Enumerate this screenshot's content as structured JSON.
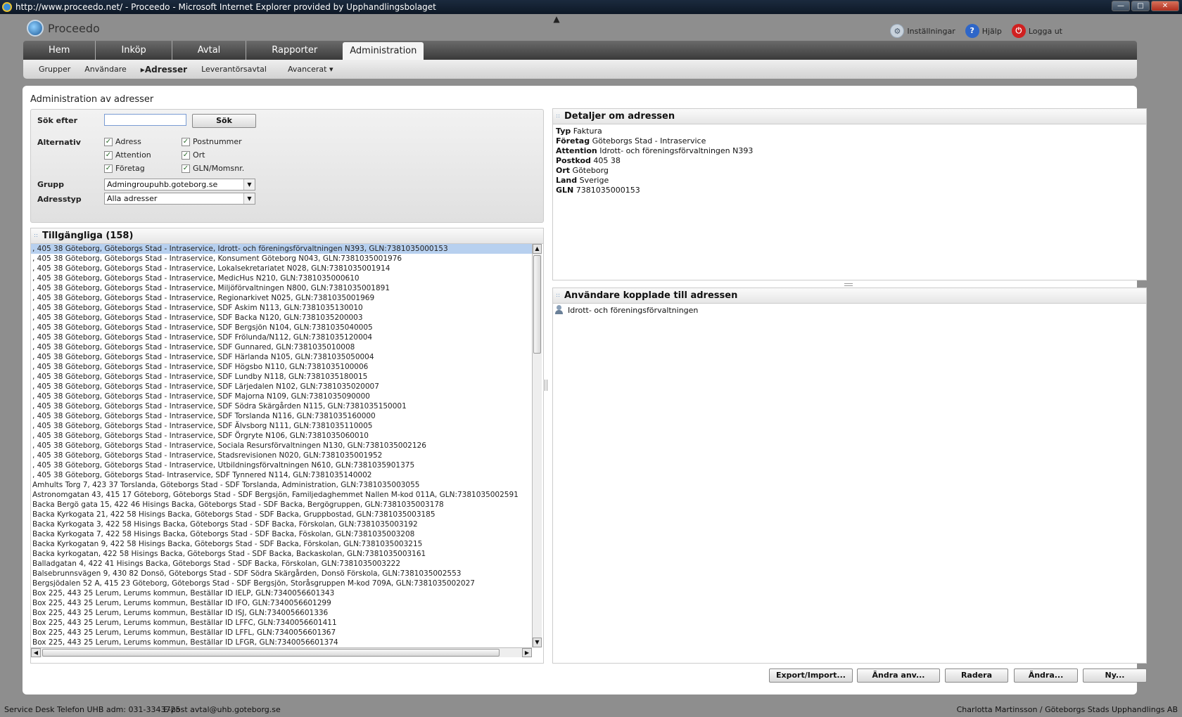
{
  "window": {
    "title": "http://www.proceedo.net/ - Proceedo - Microsoft Internet Explorer provided by Upphandlingsbolaget",
    "min": "—",
    "max": "□",
    "close": "✕"
  },
  "app": {
    "logo_text": "Proceedo",
    "toplinks": {
      "settings": "Inställningar",
      "help": "Hjälp",
      "logout": "Logga ut"
    }
  },
  "nav": {
    "tabs": [
      "Hem",
      "Inköp",
      "Avtal",
      "Rapporter",
      "Administration"
    ],
    "active": "Administration",
    "sub": [
      "Grupper",
      "Användare",
      "Adresser",
      "Leverantörsavtal",
      "Avancerat"
    ],
    "sub_active": "Adresser"
  },
  "page": {
    "title": "Administration av adresser",
    "search_label": "Sök efter",
    "search_value": "",
    "search_button": "Sök",
    "options_label": "Alternativ",
    "options": [
      {
        "label": "Adress",
        "checked": true
      },
      {
        "label": "Postnummer",
        "checked": true
      },
      {
        "label": "Attention",
        "checked": true
      },
      {
        "label": "Ort",
        "checked": true
      },
      {
        "label": "Företag",
        "checked": true
      },
      {
        "label": "GLN/Momsnr.",
        "checked": true
      }
    ],
    "group_label": "Grupp",
    "group_value": "Admingroupuhb.goteborg.se",
    "addrtype_label": "Adresstyp",
    "addrtype_value": "Alla adresser"
  },
  "list": {
    "header": "Tillgängliga (158)",
    "rows": [
      ", 405 38 Göteborg, Göteborgs Stad - Intraservice, Idrott- och föreningsförvaltningen N393, GLN:7381035000153",
      ", 405 38 Göteborg, Göteborgs Stad - Intraservice, Konsument Göteborg N043, GLN:7381035001976",
      ", 405 38 Göteborg, Göteborgs Stad - Intraservice, Lokalsekretariatet N028, GLN:7381035001914",
      ", 405 38 Göteborg, Göteborgs Stad - Intraservice, MedicHus N210, GLN:7381035000610",
      ", 405 38 Göteborg, Göteborgs Stad - Intraservice, Miljöförvaltningen N800, GLN:7381035001891",
      ", 405 38 Göteborg, Göteborgs Stad - Intraservice, Regionarkivet N025, GLN:7381035001969",
      ", 405 38 Göteborg, Göteborgs Stad - Intraservice, SDF Askim N113, GLN:7381035130010",
      ", 405 38 Göteborg, Göteborgs Stad - Intraservice, SDF Backa N120, GLN:7381035200003",
      ", 405 38 Göteborg, Göteborgs Stad - Intraservice, SDF Bergsjön N104, GLN:7381035040005",
      ", 405 38 Göteborg, Göteborgs Stad - Intraservice, SDF Frölunda/N112, GLN:7381035120004",
      ", 405 38 Göteborg, Göteborgs Stad - Intraservice, SDF Gunnared, GLN:7381035010008",
      ", 405 38 Göteborg, Göteborgs Stad - Intraservice, SDF Härlanda N105, GLN:7381035050004",
      ", 405 38 Göteborg, Göteborgs Stad - Intraservice, SDF Högsbo N110, GLN:7381035100006",
      ", 405 38 Göteborg, Göteborgs Stad - Intraservice, SDF Lundby N118, GLN:7381035180015",
      ", 405 38 Göteborg, Göteborgs Stad - Intraservice, SDF Lärjedalen N102, GLN:7381035020007",
      ", 405 38 Göteborg, Göteborgs Stad - Intraservice, SDF Majorna N109, GLN:7381035090000",
      ", 405 38 Göteborg, Göteborgs Stad - Intraservice, SDF Södra Skärgården N115, GLN:7381035150001",
      ", 405 38 Göteborg, Göteborgs Stad - Intraservice, SDF Torslanda N116, GLN:7381035160000",
      ", 405 38 Göteborg, Göteborgs Stad - Intraservice, SDF Älvsborg N111, GLN:7381035110005",
      ", 405 38 Göteborg, Göteborgs Stad - Intraservice, SDF Örgryte N106, GLN:7381035060010",
      ", 405 38 Göteborg, Göteborgs Stad - Intraservice, Sociala Resursförvaltningen N130, GLN:7381035002126",
      ", 405 38 Göteborg, Göteborgs Stad - Intraservice, Stadsrevisionen N020, GLN:7381035001952",
      ", 405 38 Göteborg, Göteborgs Stad - Intraservice, Utbildningsförvaltningen N610, GLN:7381035901375",
      ", 405 38 Göteborg, Göteborgs Stad- Intraservice, SDF Tynnered N114, GLN:7381035140002",
      "Amhults Torg 7, 423 37 Torslanda, Göteborgs Stad - SDF Torslanda, Administration, GLN:7381035003055",
      "Astronomgatan 43, 415 17 Göteborg, Göteborgs Stad - SDF Bergsjön, Familjedaghemmet Nallen M-kod 011A, GLN:7381035002591",
      "Backa Bergö gata 15, 422 46 Hisings Backa, Göteborgs Stad - SDF Backa, Bergögruppen, GLN:7381035003178",
      "Backa Kyrkogata 21, 422 58 Hisings Backa, Göteborgs Stad - SDF Backa, Gruppbostad, GLN:7381035003185",
      "Backa Kyrkogata 3, 422 58 Hisings Backa, Göteborgs Stad - SDF Backa, Förskolan, GLN:7381035003192",
      "Backa Kyrkogata 7, 422 58 Hisings Backa, Göteborgs Stad - SDF Backa, Föskolan, GLN:7381035003208",
      "Backa Kyrkogatan 9, 422 58 Hisings Backa, Göteborgs Stad - SDF Backa, Förskolan, GLN:7381035003215",
      "Backa kyrkogatan, 422 58 Hisings Backa, Göteborgs Stad - SDF Backa, Backaskolan, GLN:7381035003161",
      "Balladgatan 4, 422 41 Hisings Backa, Göteborgs Stad - SDF Backa, Förskolan, GLN:7381035003222",
      "Balsebrunnsvägen 9, 430 82 Donsö, Göteborgs Stad - SDF Södra Skärgården, Donsö Förskola, GLN:7381035002553",
      "Bergsjödalen 52 A, 415 23 Göteborg, Göteborgs Stad - SDF Bergsjön, Storåsgruppen M-kod 709A, GLN:7381035002027",
      "Box 225, 443 25 Lerum, Lerums kommun, Beställar ID IELP, GLN:7340056601343",
      "Box 225, 443 25 Lerum, Lerums kommun, Beställar ID IFO, GLN:7340056601299",
      "Box 225, 443 25 Lerum, Lerums kommun, Beställar ID ISJ, GLN:7340056601336",
      "Box 225, 443 25 Lerum, Lerums kommun, Beställar ID LFFC, GLN:7340056601411",
      "Box 225, 443 25 Lerum, Lerums kommun, Beställar ID LFFL, GLN:7340056601367",
      "Box 225, 443 25 Lerum, Lerums kommun, Beställar ID LFGR, GLN:7340056601374"
    ]
  },
  "details": {
    "header": "Detaljer om adressen",
    "fields": [
      {
        "k": "Typ",
        "v": "Faktura"
      },
      {
        "k": "Företag",
        "v": "Göteborgs Stad - Intraservice"
      },
      {
        "k": "Attention",
        "v": "Idrott- och föreningsförvaltningen N393"
      },
      {
        "k": "Postkod",
        "v": "405 38"
      },
      {
        "k": "Ort",
        "v": "Göteborg"
      },
      {
        "k": "Land",
        "v": "Sverige"
      },
      {
        "k": "GLN",
        "v": "7381035000153"
      }
    ]
  },
  "users": {
    "header": "Användare kopplade till adressen",
    "items": [
      "Idrott- och föreningsförvaltningen"
    ]
  },
  "buttons": {
    "export": "Export/Import...",
    "change_user": "Ändra anv...",
    "delete": "Radera",
    "edit": "Ändra...",
    "new": "Ny..."
  },
  "footer": {
    "left": "Service Desk Telefon UHB adm: 031-3343725",
    "left2": "E-post avtal@uhb.goteborg.se",
    "right": "Charlotta Martinsson / Göteborgs Stads Upphandlings AB"
  }
}
